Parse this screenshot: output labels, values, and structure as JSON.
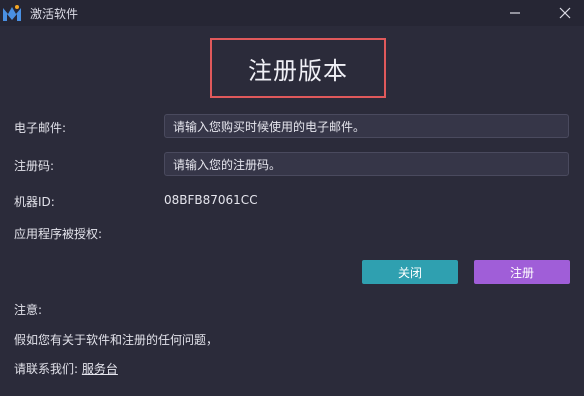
{
  "window": {
    "title": "激活软件",
    "minimize_icon": "minimize-icon",
    "close_icon": "close-icon"
  },
  "header": {
    "title": "注册版本"
  },
  "form": {
    "email_label": "电子邮件:",
    "email_placeholder": "请输入您购买时候使用的电子邮件。",
    "code_label": "注册码:",
    "code_placeholder": "请输入您的注册码。",
    "machine_label": "机器ID:",
    "machine_id": "08BFB87061CC",
    "licensed_to_label": "应用程序被授权:"
  },
  "buttons": {
    "close": "关闭",
    "register": "注册"
  },
  "notice": {
    "title": "注意:",
    "line1": "假如您有关于软件和注册的任何问题，",
    "contact_prefix": "请联系我们:",
    "contact_link": "服务台"
  },
  "colors": {
    "background": "#2b2b3a",
    "header_border": "#e0595b",
    "close_button": "#2fa0b0",
    "register_button": "#a05ed8"
  }
}
